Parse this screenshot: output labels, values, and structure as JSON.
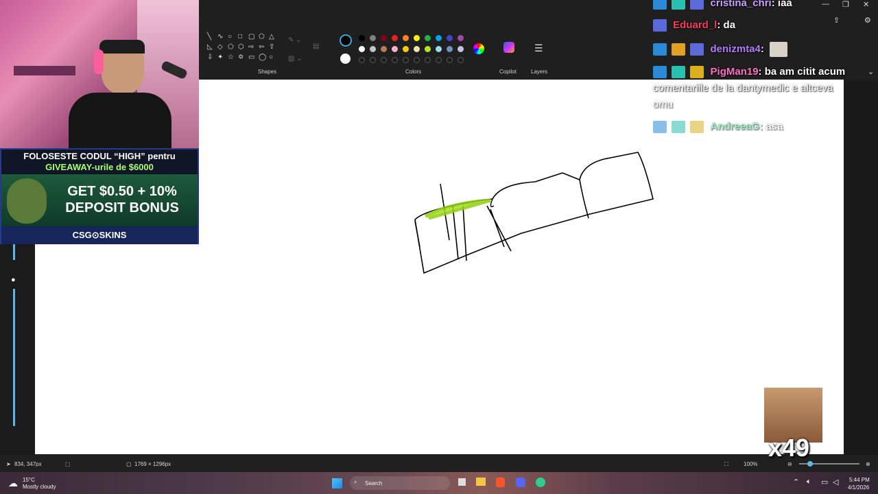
{
  "ribbon": {
    "shapes_label": "Shapes",
    "colors_label": "Colors",
    "copilot_label": "Copilot",
    "layers_label": "Layers"
  },
  "palette_row1": [
    "#000000",
    "#7f7f7f",
    "#880015",
    "#ed1c24",
    "#ff7f27",
    "#fff200",
    "#22b14c",
    "#00a2e8",
    "#3f48cc",
    "#a349a4"
  ],
  "palette_row2": [
    "#ffffff",
    "#c3c3c3",
    "#b97a57",
    "#ffaec9",
    "#ffc90e",
    "#efe4b0",
    "#b5e61d",
    "#99d9ea",
    "#7092be",
    "#c8bfe7"
  ],
  "status": {
    "cursor_pos": "834, 347px",
    "canvas_size": "1769 × 1296px",
    "zoom": "100%"
  },
  "taskbar": {
    "weather_temp": "15°C",
    "weather_desc": "Mostly cloudy",
    "search_label": "Search",
    "time": "5:44 PM",
    "date": "4/1/2026"
  },
  "promo": {
    "line1": "FOLOSESTE CODUL “HIGH” pentru",
    "line2": "GIVEAWAY-urile de $6000",
    "bonus1": "GET $0.50 + 10%",
    "bonus2": "DEPOSIT BONUS",
    "brand": "CSG⊙SKINS"
  },
  "chat": [
    {
      "user": "cristina_chri",
      "color": "#c9a0ff",
      "message": "iaa"
    },
    {
      "user": "Eduard_l",
      "color": "#ff3b5c",
      "message": "da"
    },
    {
      "user": "denizmta4",
      "color": "#b57bff",
      "message": ""
    },
    {
      "user": "PigMan19",
      "color": "#ff6fc8",
      "message": "ba am citit acum"
    },
    {
      "user": "",
      "color": "#ffffff",
      "message": "comentariile de la dantymedic e altceva"
    },
    {
      "user": "",
      "color": "#ffffff",
      "message": "omu"
    },
    {
      "user": "AndreeaG",
      "color": "#5fe0a0",
      "message": "asa"
    }
  ],
  "meme_counter": "x49"
}
